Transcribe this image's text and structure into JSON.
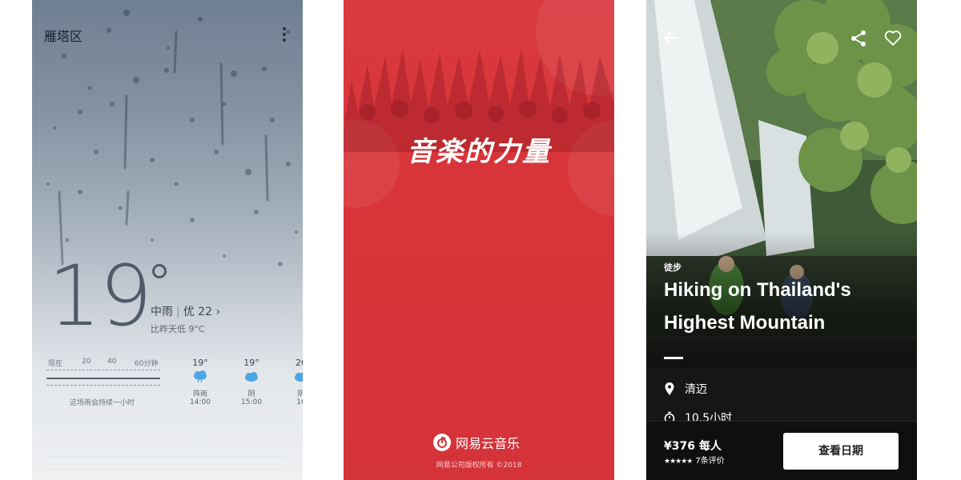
{
  "weather": {
    "location": "雁塔区",
    "temperature": "19",
    "condition": "中雨",
    "aqi_label": "优 22",
    "aqi_chevron": "›",
    "comparison": "比昨天低 9°C",
    "rain_scale": [
      "现在",
      "20",
      "40",
      "60分钟"
    ],
    "rain_message": "这场雨会持续一小时",
    "forecast": [
      {
        "temp": "19°",
        "desc": "阵雨",
        "time": "14:00",
        "icon": "rain-cloud-icon"
      },
      {
        "temp": "19°",
        "desc": "阴",
        "time": "15:00",
        "icon": "cloud-icon"
      },
      {
        "temp": "20",
        "desc": "阴",
        "time": "16",
        "icon": "cloud-icon"
      }
    ]
  },
  "music": {
    "slogan": "音楽的力量",
    "app_name": "网易云音乐",
    "copyright": "网易公司版权所有 ©2018",
    "colors": {
      "brand_red": "#d8343a"
    }
  },
  "hike": {
    "category": "徒步",
    "title": "Hiking on Thailand's Highest Mountain",
    "location": "清迈",
    "duration": "10.5小时",
    "price": "¥376 每人",
    "rating_stars": "★★★★★",
    "rating_value": 4.5,
    "reviews": "7条评价",
    "cta": "查看日期"
  }
}
